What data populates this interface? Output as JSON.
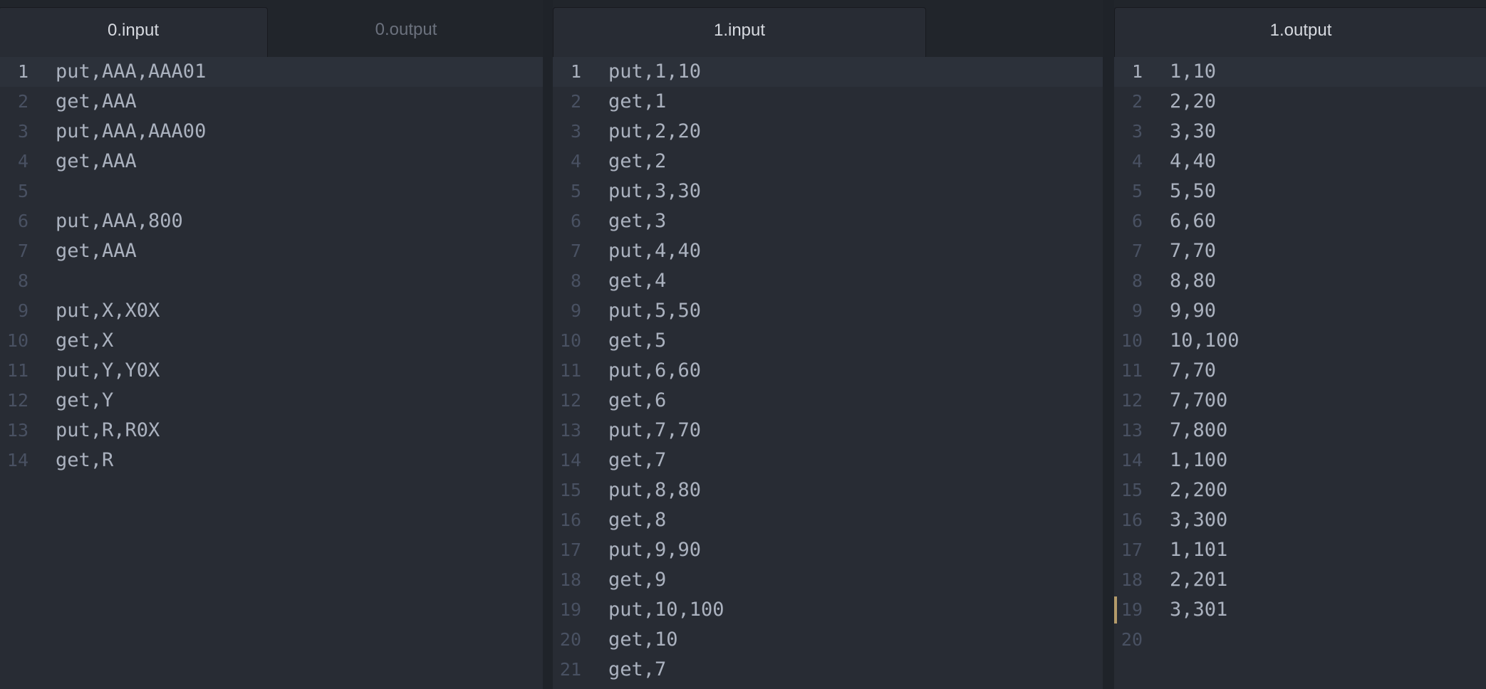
{
  "panes": [
    {
      "id": "pane-0",
      "tabs": [
        {
          "label": "0.input",
          "active": true
        },
        {
          "label": "0.output",
          "active": false
        }
      ],
      "cursor_line": 1,
      "lines": [
        "put,AAA,AAA01",
        "get,AAA",
        "put,AAA,AAA00",
        "get,AAA",
        "",
        "put,AAA,800",
        "get,AAA",
        "",
        "put,X,X0X",
        "get,X",
        "put,Y,Y0X",
        "get,Y",
        "put,R,R0X",
        "get,R"
      ]
    },
    {
      "id": "pane-1",
      "tabs": [
        {
          "label": "1.input",
          "active": true
        }
      ],
      "cursor_line": 1,
      "lines": [
        "put,1,10",
        "get,1",
        "put,2,20",
        "get,2",
        "put,3,30",
        "get,3",
        "put,4,40",
        "get,4",
        "put,5,50",
        "get,5",
        "put,6,60",
        "get,6",
        "put,7,70",
        "get,7",
        "put,8,80",
        "get,8",
        "put,9,90",
        "get,9",
        "put,10,100",
        "get,10",
        "get,7"
      ]
    },
    {
      "id": "pane-2",
      "tabs": [
        {
          "label": "1.output",
          "active": true
        }
      ],
      "cursor_line": 1,
      "modified_line": 19,
      "lines": [
        "1,10",
        "2,20",
        "3,30",
        "4,40",
        "5,50",
        "6,60",
        "7,70",
        "8,80",
        "9,90",
        "10,100",
        "7,70",
        "7,700",
        "7,800",
        "1,100",
        "2,200",
        "3,300",
        "1,101",
        "2,201",
        "3,301",
        ""
      ]
    }
  ]
}
